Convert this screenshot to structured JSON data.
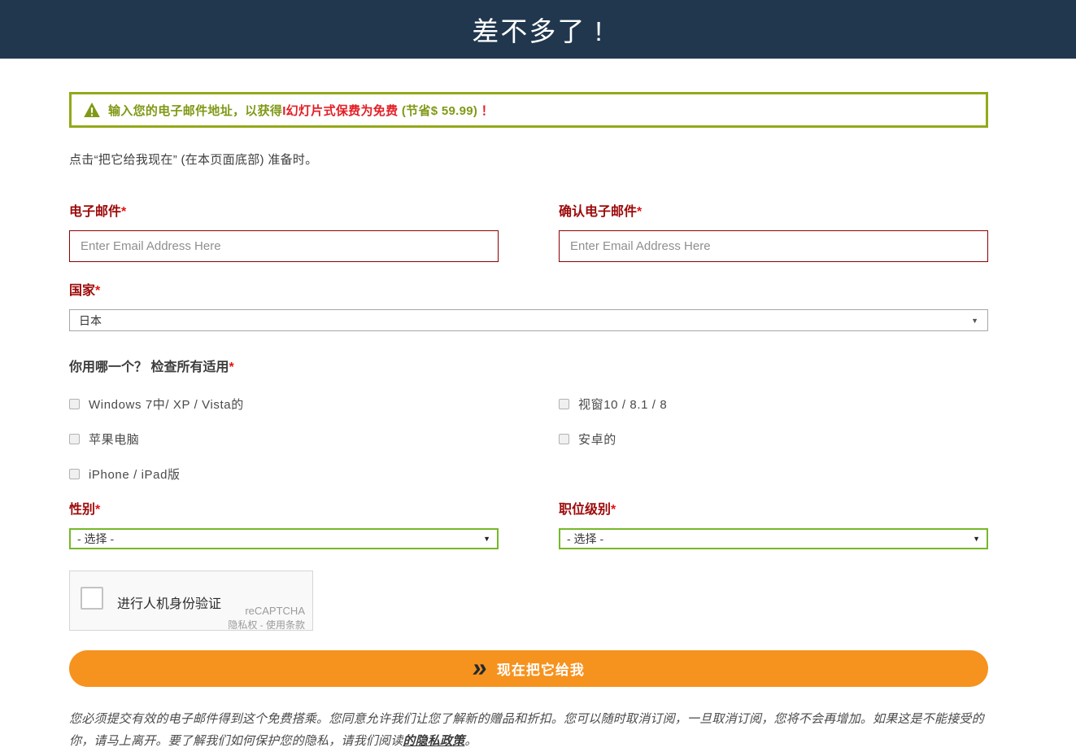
{
  "colors": {
    "header_bg": "#20374e",
    "accent_orange": "#f6921e",
    "alert_border_green": "#93a919",
    "alert_text_green": "#7f9916",
    "alert_text_red": "#e31e24",
    "label_dark_red": "#9c0909",
    "input_border_red": "#8b0000",
    "select_border_green": "#76b82a"
  },
  "header": {
    "title": "差不多了 !"
  },
  "alert": {
    "icon": "warning-icon",
    "segments": [
      {
        "text": "输入您的电子邮件地址，以获得",
        "color": "green"
      },
      {
        "text": "I幻灯片式保费为免费",
        "color": "red"
      },
      {
        "text": " (节省$ 59.99) ",
        "color": "green"
      },
      {
        "text": "！",
        "color": "red"
      }
    ]
  },
  "intro": {
    "text": "点击“把它给我现在” (在本页面底部) 准备时。"
  },
  "form": {
    "required_mark": "*",
    "email": {
      "label": "电子邮件",
      "placeholder": "Enter Email Address Here",
      "value": ""
    },
    "confirm_email": {
      "label": "确认电子邮件",
      "placeholder": "Enter Email Address Here",
      "value": ""
    },
    "country": {
      "label": "国家",
      "value": "日本"
    },
    "usage": {
      "label": "你用哪一个？ 检查所有适用",
      "options": [
        {
          "label": "Windows 7中/ XP / Vista的",
          "checked": false
        },
        {
          "label": "视窗10 / 8.1 / 8",
          "checked": false
        },
        {
          "label": "苹果电脑",
          "checked": false
        },
        {
          "label": "安卓的",
          "checked": false
        },
        {
          "label": "iPhone / iPad版",
          "checked": false
        }
      ]
    },
    "gender": {
      "label": "性别",
      "value": "- 选择 -"
    },
    "job_level": {
      "label": "职位级别",
      "value": "- 选择 -"
    }
  },
  "recaptcha": {
    "label": "进行人机身份验证",
    "brand": "reCAPTCHA",
    "links": "隐私权 - 使用条款",
    "checked": false
  },
  "submit": {
    "label": "现在把它给我",
    "icon_glyph": "»"
  },
  "footer": {
    "text_before_link": "您必须提交有效的电子邮件得到这个免费搭乘。您同意允许我们让您了解新的赠品和折扣。您可以随时取消订阅，一旦取消订阅，您将不会再增加。如果这是不能接受的你，请马上离开。要了解我们如何保护您的隐私，请我们阅读",
    "link": "的隐私政策",
    "text_after_link": "。"
  }
}
